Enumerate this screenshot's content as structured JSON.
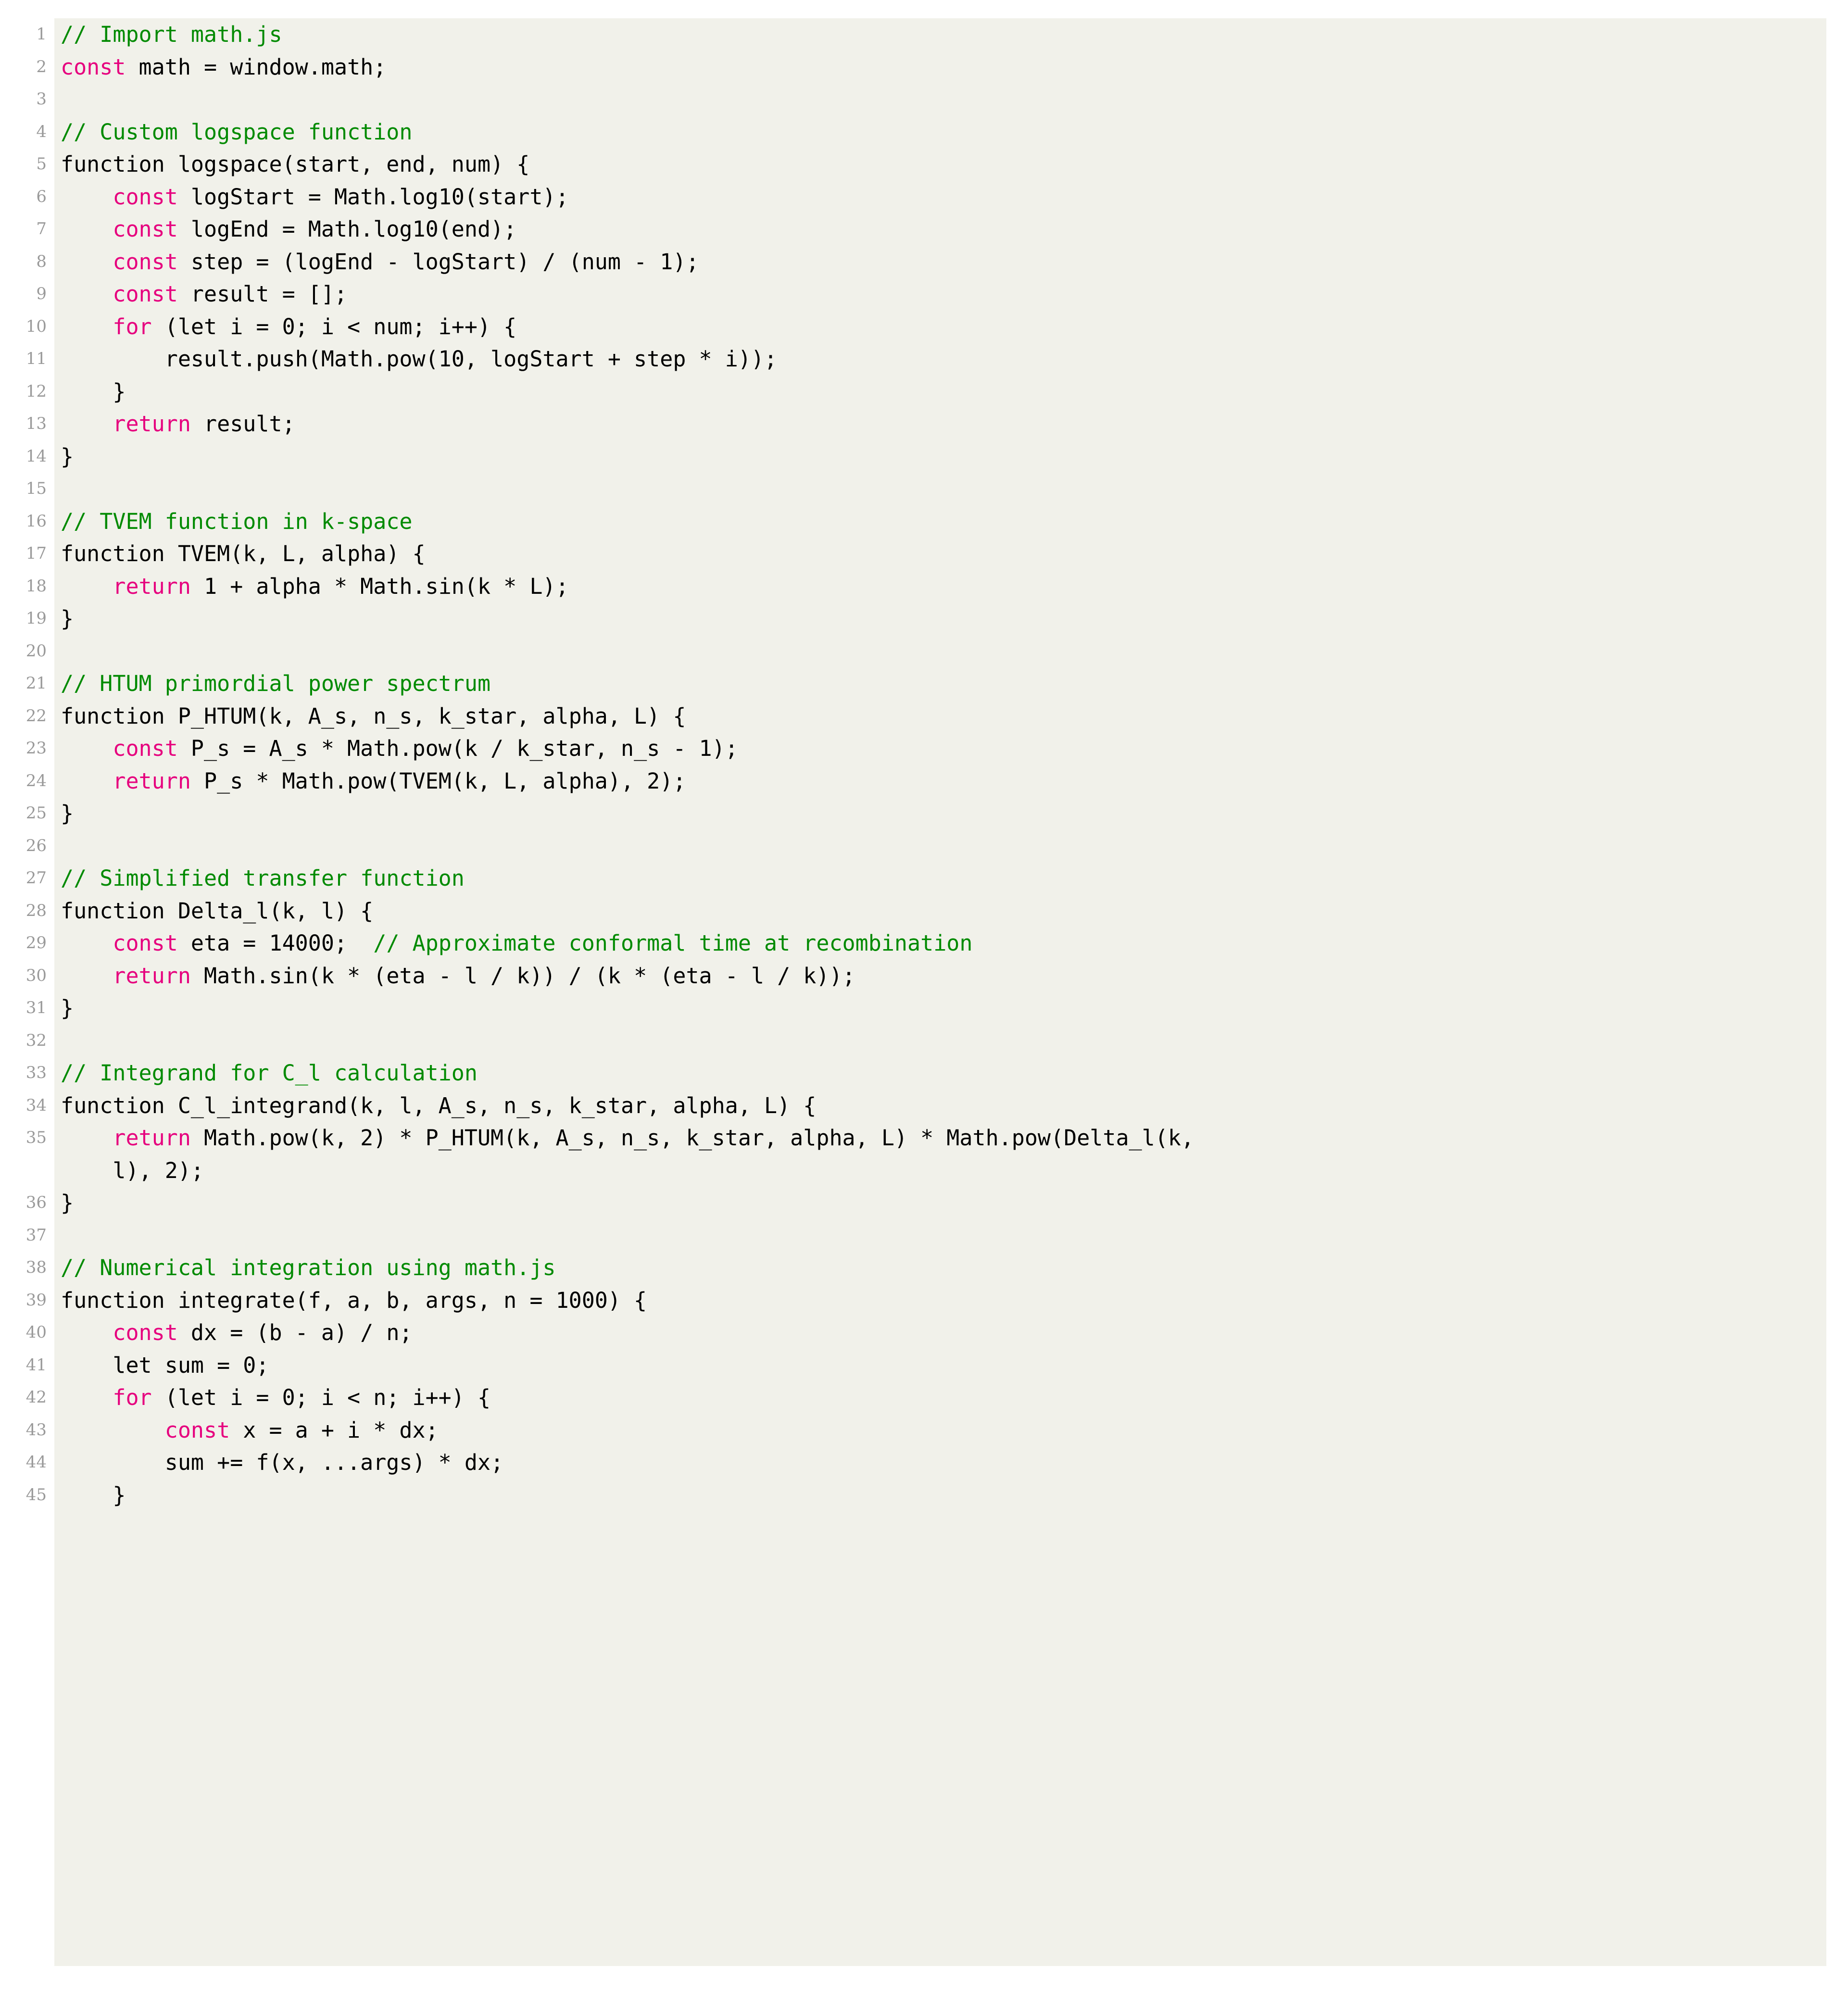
{
  "listing": {
    "language": "javascript",
    "background_color": "#f1f1ea",
    "page_color": "#ffffff",
    "gutter_color": "#9a9a9a",
    "colors": {
      "comment": "#008a00",
      "keyword": "#e6007e",
      "text": "#000000"
    },
    "first_line_number": 1,
    "last_line_number": 45,
    "lines": [
      {
        "n": "1",
        "tokens": [
          {
            "t": "comment",
            "s": "// Import math.js"
          }
        ]
      },
      {
        "n": "2",
        "tokens": [
          {
            "t": "kw",
            "s": "const"
          },
          {
            "t": "plain",
            "s": " math = window.math;"
          }
        ]
      },
      {
        "n": "3",
        "tokens": [
          {
            "t": "plain",
            "s": ""
          }
        ]
      },
      {
        "n": "4",
        "tokens": [
          {
            "t": "comment",
            "s": "// Custom logspace function"
          }
        ]
      },
      {
        "n": "5",
        "tokens": [
          {
            "t": "plain",
            "s": "function logspace(start, end, num) {"
          }
        ]
      },
      {
        "n": "6",
        "tokens": [
          {
            "t": "plain",
            "s": "    "
          },
          {
            "t": "kw",
            "s": "const"
          },
          {
            "t": "plain",
            "s": " logStart = Math.log10(start);"
          }
        ]
      },
      {
        "n": "7",
        "tokens": [
          {
            "t": "plain",
            "s": "    "
          },
          {
            "t": "kw",
            "s": "const"
          },
          {
            "t": "plain",
            "s": " logEnd = Math.log10(end);"
          }
        ]
      },
      {
        "n": "8",
        "tokens": [
          {
            "t": "plain",
            "s": "    "
          },
          {
            "t": "kw",
            "s": "const"
          },
          {
            "t": "plain",
            "s": " step = (logEnd - logStart) / (num - 1);"
          }
        ]
      },
      {
        "n": "9",
        "tokens": [
          {
            "t": "plain",
            "s": "    "
          },
          {
            "t": "kw",
            "s": "const"
          },
          {
            "t": "plain",
            "s": " result = [];"
          }
        ]
      },
      {
        "n": "10",
        "tokens": [
          {
            "t": "plain",
            "s": "    "
          },
          {
            "t": "kw",
            "s": "for"
          },
          {
            "t": "plain",
            "s": " (let i = 0; i < num; i++) {"
          }
        ]
      },
      {
        "n": "11",
        "tokens": [
          {
            "t": "plain",
            "s": "        result.push(Math.pow(10, logStart + step * i));"
          }
        ]
      },
      {
        "n": "12",
        "tokens": [
          {
            "t": "plain",
            "s": "    }"
          }
        ]
      },
      {
        "n": "13",
        "tokens": [
          {
            "t": "plain",
            "s": "    "
          },
          {
            "t": "kw",
            "s": "return"
          },
          {
            "t": "plain",
            "s": " result;"
          }
        ]
      },
      {
        "n": "14",
        "tokens": [
          {
            "t": "plain",
            "s": "}"
          }
        ]
      },
      {
        "n": "15",
        "tokens": [
          {
            "t": "plain",
            "s": ""
          }
        ]
      },
      {
        "n": "16",
        "tokens": [
          {
            "t": "comment",
            "s": "// TVEM function in k-space"
          }
        ]
      },
      {
        "n": "17",
        "tokens": [
          {
            "t": "plain",
            "s": "function TVEM(k, L, alpha) {"
          }
        ]
      },
      {
        "n": "18",
        "tokens": [
          {
            "t": "plain",
            "s": "    "
          },
          {
            "t": "kw",
            "s": "return"
          },
          {
            "t": "plain",
            "s": " 1 + alpha * Math.sin(k * L);"
          }
        ]
      },
      {
        "n": "19",
        "tokens": [
          {
            "t": "plain",
            "s": "}"
          }
        ]
      },
      {
        "n": "20",
        "tokens": [
          {
            "t": "plain",
            "s": ""
          }
        ]
      },
      {
        "n": "21",
        "tokens": [
          {
            "t": "comment",
            "s": "// HTUM primordial power spectrum"
          }
        ]
      },
      {
        "n": "22",
        "tokens": [
          {
            "t": "plain",
            "s": "function P_HTUM(k, A_s, n_s, k_star, alpha, L) {"
          }
        ]
      },
      {
        "n": "23",
        "tokens": [
          {
            "t": "plain",
            "s": "    "
          },
          {
            "t": "kw",
            "s": "const"
          },
          {
            "t": "plain",
            "s": " P_s = A_s * Math.pow(k / k_star, n_s - 1);"
          }
        ]
      },
      {
        "n": "24",
        "tokens": [
          {
            "t": "plain",
            "s": "    "
          },
          {
            "t": "kw",
            "s": "return"
          },
          {
            "t": "plain",
            "s": " P_s * Math.pow(TVEM(k, L, alpha), 2);"
          }
        ]
      },
      {
        "n": "25",
        "tokens": [
          {
            "t": "plain",
            "s": "}"
          }
        ]
      },
      {
        "n": "26",
        "tokens": [
          {
            "t": "plain",
            "s": ""
          }
        ]
      },
      {
        "n": "27",
        "tokens": [
          {
            "t": "comment",
            "s": "// Simplified transfer function"
          }
        ]
      },
      {
        "n": "28",
        "tokens": [
          {
            "t": "plain",
            "s": "function Delta_l(k, l) {"
          }
        ]
      },
      {
        "n": "29",
        "tokens": [
          {
            "t": "plain",
            "s": "    "
          },
          {
            "t": "kw",
            "s": "const"
          },
          {
            "t": "plain",
            "s": " eta = 14000;  "
          },
          {
            "t": "comment",
            "s": "// Approximate conformal time at recombination"
          }
        ]
      },
      {
        "n": "30",
        "tokens": [
          {
            "t": "plain",
            "s": "    "
          },
          {
            "t": "kw",
            "s": "return"
          },
          {
            "t": "plain",
            "s": " Math.sin(k * (eta - l / k)) / (k * (eta - l / k));"
          }
        ]
      },
      {
        "n": "31",
        "tokens": [
          {
            "t": "plain",
            "s": "}"
          }
        ]
      },
      {
        "n": "32",
        "tokens": [
          {
            "t": "plain",
            "s": ""
          }
        ]
      },
      {
        "n": "33",
        "tokens": [
          {
            "t": "comment",
            "s": "// Integrand for C_l calculation"
          }
        ]
      },
      {
        "n": "34",
        "tokens": [
          {
            "t": "plain",
            "s": "function C_l_integrand(k, l, A_s, n_s, k_star, alpha, L) {"
          }
        ]
      },
      {
        "n": "35",
        "tokens": [
          {
            "t": "plain",
            "s": "    "
          },
          {
            "t": "kw",
            "s": "return"
          },
          {
            "t": "plain",
            "s": " Math.pow(k, 2) * P_HTUM(k, A_s, n_s, k_star, alpha, L) * Math.pow(Delta_l(k,"
          }
        ]
      },
      {
        "n": "",
        "cont": true,
        "tokens": [
          {
            "t": "plain",
            "s": "    l), 2);"
          }
        ]
      },
      {
        "n": "36",
        "tokens": [
          {
            "t": "plain",
            "s": "}"
          }
        ]
      },
      {
        "n": "37",
        "tokens": [
          {
            "t": "plain",
            "s": ""
          }
        ]
      },
      {
        "n": "38",
        "tokens": [
          {
            "t": "comment",
            "s": "// Numerical integration using math.js"
          }
        ]
      },
      {
        "n": "39",
        "tokens": [
          {
            "t": "plain",
            "s": "function integrate(f, a, b, args, n = 1000) {"
          }
        ]
      },
      {
        "n": "40",
        "tokens": [
          {
            "t": "plain",
            "s": "    "
          },
          {
            "t": "kw",
            "s": "const"
          },
          {
            "t": "plain",
            "s": " dx = (b - a) / n;"
          }
        ]
      },
      {
        "n": "41",
        "tokens": [
          {
            "t": "plain",
            "s": "    let sum = 0;"
          }
        ]
      },
      {
        "n": "42",
        "tokens": [
          {
            "t": "plain",
            "s": "    "
          },
          {
            "t": "kw",
            "s": "for"
          },
          {
            "t": "plain",
            "s": " (let i = 0; i < n; i++) {"
          }
        ]
      },
      {
        "n": "43",
        "tokens": [
          {
            "t": "plain",
            "s": "        "
          },
          {
            "t": "kw",
            "s": "const"
          },
          {
            "t": "plain",
            "s": " x = a + i * dx;"
          }
        ]
      },
      {
        "n": "44",
        "tokens": [
          {
            "t": "plain",
            "s": "        sum += f(x, ...args) * dx;"
          }
        ]
      },
      {
        "n": "45",
        "tokens": [
          {
            "t": "plain",
            "s": "    }"
          }
        ]
      }
    ]
  }
}
